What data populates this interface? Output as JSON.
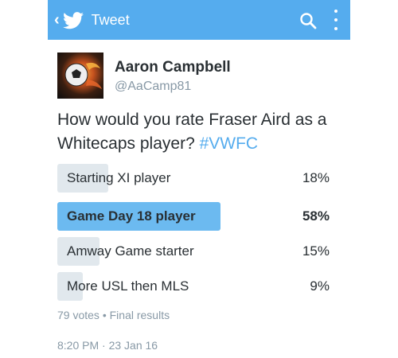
{
  "appbar": {
    "back_label": "‹",
    "title": "Tweet",
    "background": "#55acee",
    "icons": [
      "twitter-bird-icon",
      "search-icon",
      "more-vertical-icon"
    ]
  },
  "tweet": {
    "author_name": "Aaron Campbell",
    "author_handle": "@AaCamp81",
    "text": "How would you rate Fraser Aird as a Whitecaps player? ",
    "hashtag": "#VWFC",
    "timestamp": "8:20 PM · 23 Jan 16"
  },
  "poll": {
    "options": [
      {
        "label": "Starting XI player",
        "percent_label": "18%",
        "percent": 18,
        "winner": false
      },
      {
        "label": "Game Day 18 player",
        "percent_label": "58%",
        "percent": 58,
        "winner": true
      },
      {
        "label": "Amway Game starter",
        "percent_label": "15%",
        "percent": 15,
        "winner": false
      },
      {
        "label": "More USL then MLS",
        "percent_label": "9%",
        "percent": 9,
        "winner": false
      }
    ],
    "votes_text": "79 votes",
    "separator": "•",
    "status_text": "Final results"
  },
  "colors": {
    "accent": "#55acee",
    "winner_bar": "#6cbaf0",
    "bar": "#e1e8ed",
    "muted_text": "#8899a6"
  }
}
